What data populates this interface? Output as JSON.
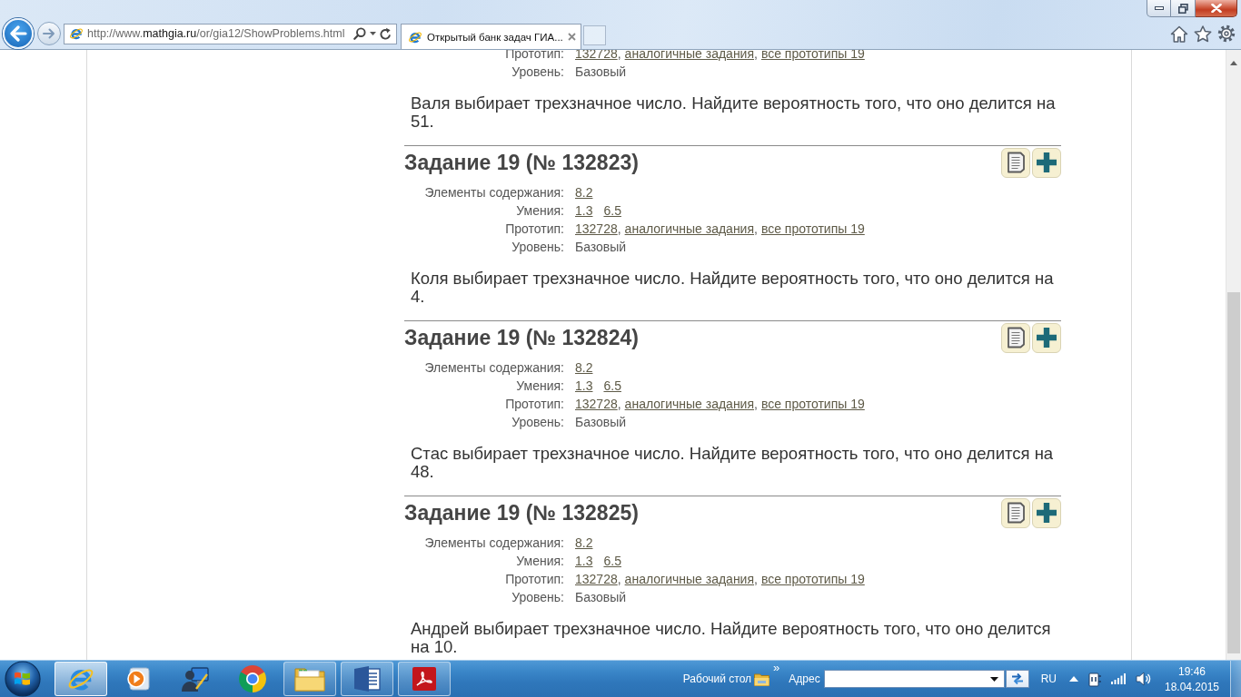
{
  "browser": {
    "address": {
      "scheme": "http://www.",
      "domain": "mathgia.ru",
      "path": "/or/gia12/ShowProblems.html"
    },
    "tabs": [
      {
        "title": "Открытый банк задач ГИА...",
        "selected": true
      }
    ]
  },
  "problems": [
    {
      "meta": [
        {
          "label": "Прототип:",
          "kind": "links",
          "links": [
            "132728",
            "аналогичные задания",
            "все прототипы 19"
          ],
          "separator": ","
        },
        {
          "label": "Уровень:",
          "kind": "text",
          "value": "Базовый"
        }
      ],
      "text": "Валя выбирает трехзначное число. Найдите вероятность того, что оно делится на 51."
    },
    {
      "title": "Задание 19 (№ 132823)",
      "meta": [
        {
          "label": "Элементы содержания:",
          "kind": "links",
          "links": [
            "8.2"
          ]
        },
        {
          "label": "Умения:",
          "kind": "links",
          "links": [
            "1.3",
            "6.5"
          ]
        },
        {
          "label": "Прототип:",
          "kind": "links",
          "links": [
            "132728",
            "аналогичные задания",
            "все прототипы 19"
          ],
          "separator": ","
        },
        {
          "label": "Уровень:",
          "kind": "text",
          "value": "Базовый"
        }
      ],
      "text": "Коля выбирает трехзначное число. Найдите вероятность того, что оно делится на 4."
    },
    {
      "title": "Задание 19 (№ 132824)",
      "meta": [
        {
          "label": "Элементы содержания:",
          "kind": "links",
          "links": [
            "8.2"
          ]
        },
        {
          "label": "Умения:",
          "kind": "links",
          "links": [
            "1.3",
            "6.5"
          ]
        },
        {
          "label": "Прототип:",
          "kind": "links",
          "links": [
            "132728",
            "аналогичные задания",
            "все прототипы 19"
          ],
          "separator": ","
        },
        {
          "label": "Уровень:",
          "kind": "text",
          "value": "Базовый"
        }
      ],
      "text": "Стас выбирает трехзначное число. Найдите вероятность того, что оно делится на 48."
    },
    {
      "title": "Задание 19 (№ 132825)",
      "meta": [
        {
          "label": "Элементы содержания:",
          "kind": "links",
          "links": [
            "8.2"
          ]
        },
        {
          "label": "Умения:",
          "kind": "links",
          "links": [
            "1.3",
            "6.5"
          ]
        },
        {
          "label": "Прототип:",
          "kind": "links",
          "links": [
            "132728",
            "аналогичные задания",
            "все прототипы 19"
          ],
          "separator": ","
        },
        {
          "label": "Уровень:",
          "kind": "text",
          "value": "Базовый"
        }
      ],
      "text": "Андрей выбирает трехзначное число. Найдите вероятность того, что оно делится на 10."
    }
  ],
  "taskbar": {
    "apps": [
      {
        "kind": "ie",
        "running": true,
        "selected": true
      },
      {
        "kind": "media",
        "running": false,
        "selected": false
      },
      {
        "kind": "remote",
        "running": false,
        "selected": false
      },
      {
        "kind": "chrome",
        "running": false,
        "selected": false
      },
      {
        "kind": "explorer",
        "running": true,
        "selected": false
      },
      {
        "kind": "word",
        "running": true,
        "selected": false
      },
      {
        "kind": "acrobat",
        "running": true,
        "selected": false
      }
    ],
    "desktop_label": "Рабочий стол",
    "chevron": "»",
    "address_label": "Адрес",
    "language": "RU",
    "time": "19:46",
    "date": "18.04.2015"
  }
}
